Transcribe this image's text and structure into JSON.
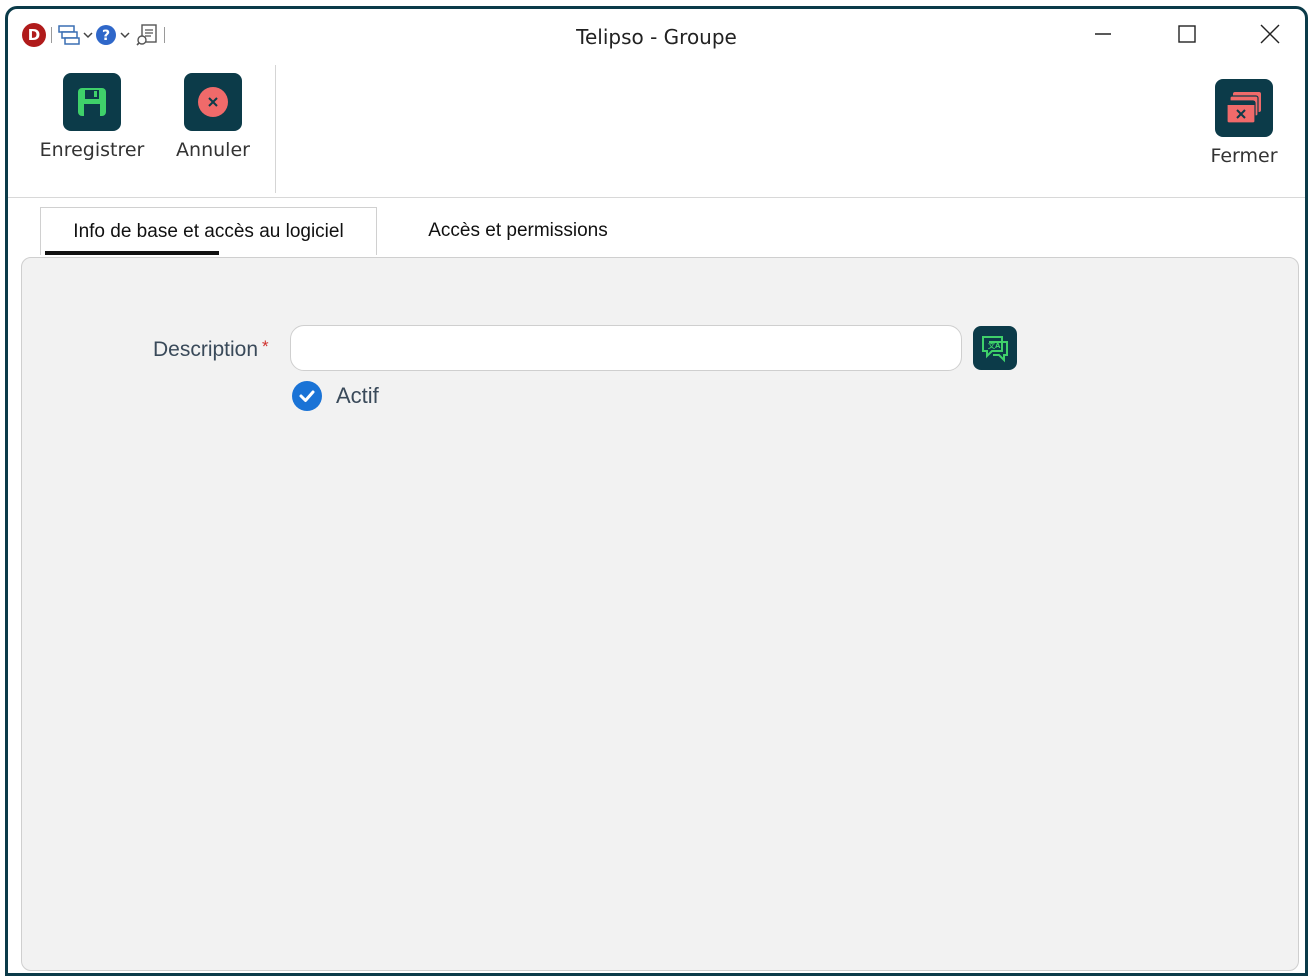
{
  "window": {
    "title": "Telipso - Groupe"
  },
  "quick_access": {
    "logo_letter": "D",
    "icons": [
      "app-logo-icon",
      "windows-stack-icon",
      "help-icon",
      "document-search-icon"
    ]
  },
  "ribbon": {
    "save_label": "Enregistrer",
    "cancel_label": "Annuler",
    "close_label": "Fermer"
  },
  "tabs": [
    {
      "label": "Info de base et accès au logiciel",
      "active": true
    },
    {
      "label": "Accès et permissions",
      "active": false
    }
  ],
  "form": {
    "description_label": "Description",
    "required_marker": "*",
    "description_value": "",
    "active_label": "Actif",
    "active_checked": true
  },
  "colors": {
    "accent_dark": "#0c3b49",
    "save_green": "#3fd16a",
    "cancel_red": "#f06a6a",
    "checkbox_blue": "#1a73d6",
    "required_red": "#d0312d"
  }
}
